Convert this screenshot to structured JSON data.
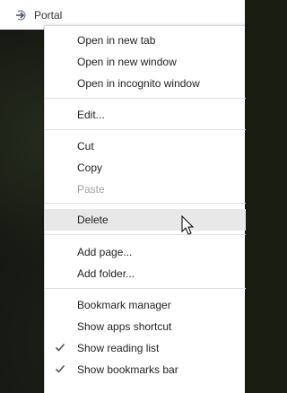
{
  "bookmark_bar": {
    "item_label": "Portal",
    "item_icon": "portal-favicon-icon"
  },
  "context_menu": {
    "open_new_tab": "Open in new tab",
    "open_new_window": "Open in new window",
    "open_incognito": "Open in incognito window",
    "edit": "Edit...",
    "cut": "Cut",
    "copy": "Copy",
    "paste": "Paste",
    "delete": "Delete",
    "add_page": "Add page...",
    "add_folder": "Add folder...",
    "bookmark_manager": "Bookmark manager",
    "show_apps_shortcut": "Show apps shortcut",
    "show_reading_list": "Show reading list",
    "show_bookmarks_bar": "Show bookmarks bar",
    "checked_items": [
      "show_reading_list",
      "show_bookmarks_bar"
    ],
    "disabled_items": [
      "paste"
    ],
    "hovered_item": "delete"
  },
  "colors": {
    "menu_background": "#ffffff",
    "hover_background": "#e8e8e8",
    "disabled_text": "#a0a0a0",
    "page_background": "#151811"
  },
  "icons": [
    "portal-favicon-icon",
    "checkmark-icon",
    "mouse-pointer-icon"
  ]
}
